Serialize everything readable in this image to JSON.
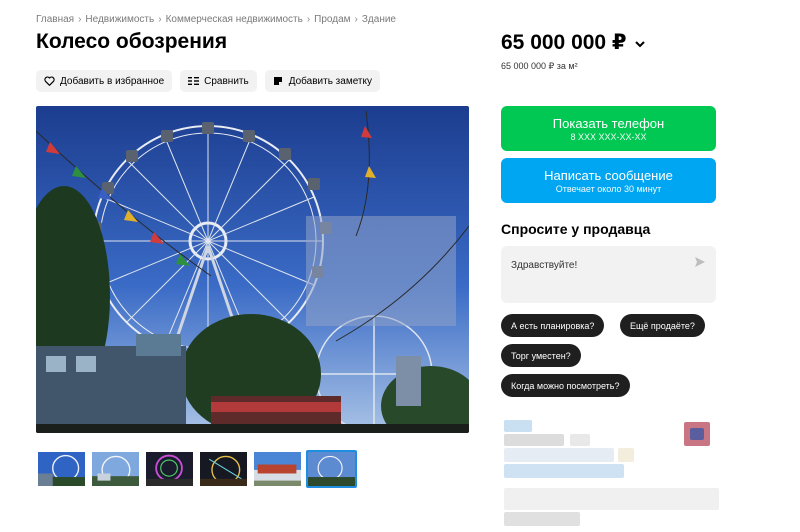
{
  "breadcrumb": [
    "Главная",
    "Недвижимость",
    "Коммерческая недвижимость",
    "Продам",
    "Здание"
  ],
  "title": "Колесо обозрения",
  "actions": {
    "favorite": "Добавить в избранное",
    "compare": "Сравнить",
    "note": "Добавить заметку"
  },
  "icons": {
    "favorite": "heart-icon",
    "compare": "compare-icon",
    "note": "note-icon",
    "price_menu": "chevron-down-icon",
    "send": "send-icon"
  },
  "price": {
    "value": "65 000 000 ₽",
    "per_unit": "65 000 000 ₽ за м²"
  },
  "contact": {
    "phone_label": "Показать телефон",
    "phone_mask": "8 XXX XXX-XX-XX",
    "message_label": "Написать сообщение",
    "message_sub": "Отвечает около 30 минут"
  },
  "ask": {
    "title": "Спросите у продавца",
    "input_value": "Здравствуйте!",
    "quick_questions": [
      "А есть планировка?",
      "Ещё продаёте?",
      "Торг уместен?",
      "Когда можно посмотреть?"
    ]
  },
  "gallery": {
    "thumb_count": 6,
    "active_index": 5
  },
  "colors": {
    "green": "#00c853",
    "blue": "#00a6f2",
    "dark_chip": "#1f1f1f",
    "light_chip": "#f2f2f2"
  }
}
